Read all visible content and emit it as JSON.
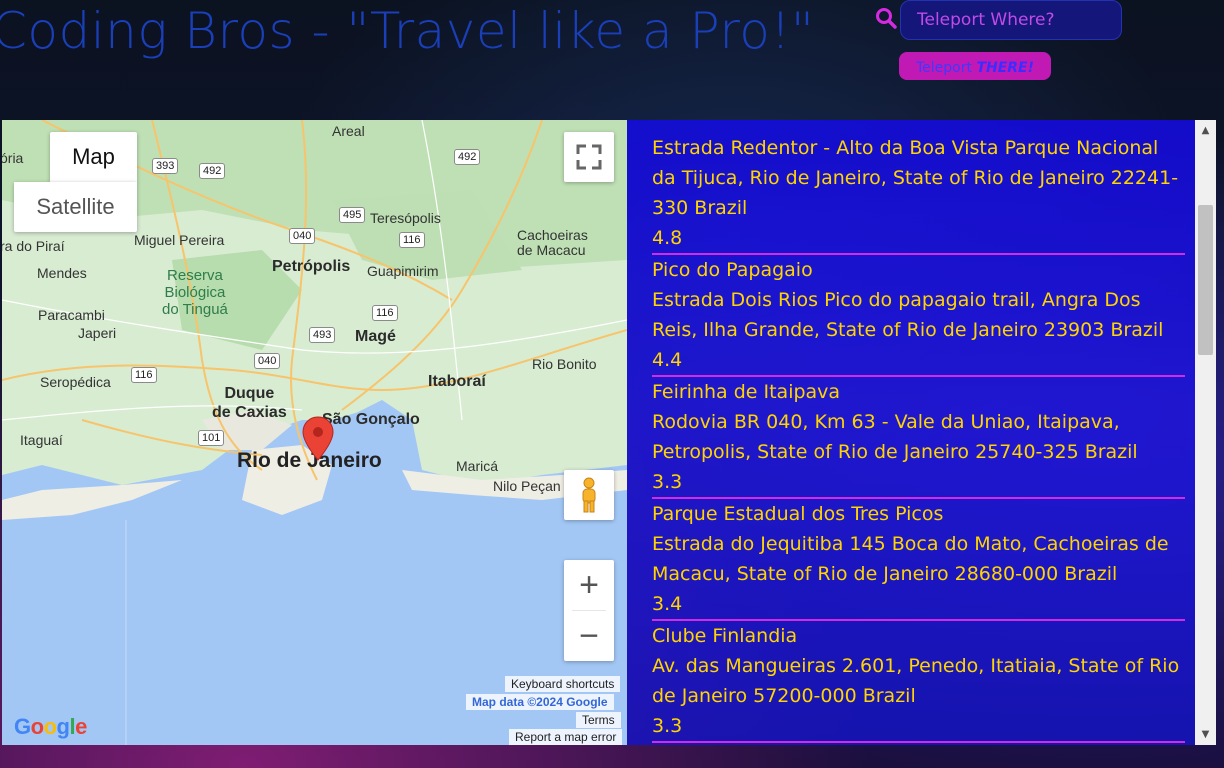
{
  "header": {
    "title": "Coding Bros - \"Travel like a Pro!\"",
    "search_placeholder": "Teleport Where?",
    "search_value": "",
    "teleport_label": "Teleport ",
    "teleport_emphasis": "THERE!"
  },
  "map": {
    "type_map": "Map",
    "type_satellite": "Satellite",
    "zoom_in": "+",
    "zoom_out": "−",
    "keyboard_shortcuts": "Keyboard shortcuts",
    "map_data": "Map data ©2024 Google",
    "terms": "Terms",
    "report_error": "Report a map error",
    "google_logo": "Google",
    "labels": {
      "areal": "Areal",
      "teresopolis": "Teresópolis",
      "cachoeiras": "Cachoeiras\nde Macacu",
      "miguel_pereira": "Miguel Pereira",
      "dorai": "ra do Piraí",
      "mendes": "Mendes",
      "reserva": "Reserva\nBiológica\ndo Tinguá",
      "petropolis": "Petrópolis",
      "guapimirim": "Guapimirim",
      "paracambi": "Paracambi",
      "japeri": "Japeri",
      "mage": "Magé",
      "rio_bonito": "Rio Bonito",
      "seropedica": "Seropédica",
      "duque": "Duque\nde Caxias",
      "itaborai": "Itaboraí",
      "sao_goncalo": "São Gonçalo",
      "itaguai": "Itaguaí",
      "rio": "Rio de Janeiro",
      "marica": "Maricá",
      "nilo": "Nilo Peçan",
      "oria": "ória"
    },
    "shields": {
      "s393": "393",
      "s492a": "492",
      "s492b": "492",
      "s495": "495",
      "s040a": "040",
      "s116a": "116",
      "s116b": "116",
      "s493": "493",
      "s040b": "040",
      "s116c": "116",
      "s101": "101"
    }
  },
  "results": {
    "items": [
      {
        "name": "",
        "address": "Estrada Redentor - Alto da Boa Vista Parque Nacional da Tijuca, Rio de Janeiro, State of Rio de Janeiro 22241-330 Brazil",
        "rating": "4.8"
      },
      {
        "name": "Pico do Papagaio",
        "address": "Estrada Dois Rios Pico do papagaio trail, Angra Dos Reis, Ilha Grande, State of Rio de Janeiro 23903 Brazil",
        "rating": "4.4"
      },
      {
        "name": "Feirinha de Itaipava",
        "address": "Rodovia BR 040, Km 63 - Vale da Uniao, Itaipava, Petropolis, State of Rio de Janeiro 25740-325 Brazil",
        "rating": "3.3"
      },
      {
        "name": "Parque Estadual dos Tres Picos",
        "address": "Estrada do Jequitiba 145 Boca do Mato, Cachoeiras de Macacu, State of Rio de Janeiro 28680-000 Brazil",
        "rating": "3.4"
      },
      {
        "name": "Clube Finlandia",
        "address": "Av. das Mangueiras 2.601, Penedo, Itatiaia, State of Rio de Janeiro 57200-000 Brazil",
        "rating": "3.3"
      }
    ],
    "scroll_up": "▲",
    "scroll_down": "▼"
  },
  "colors": {
    "title": "#1a3fb8",
    "result_text": "#ffd400",
    "result_divider": "#d42ae0",
    "button_bg": "#c11ab4",
    "input_bg": "#15167a"
  },
  "icons": {
    "search": "search-icon",
    "fullscreen": "fullscreen-icon",
    "pegman": "pegman-icon",
    "marker": "map-marker-icon"
  }
}
